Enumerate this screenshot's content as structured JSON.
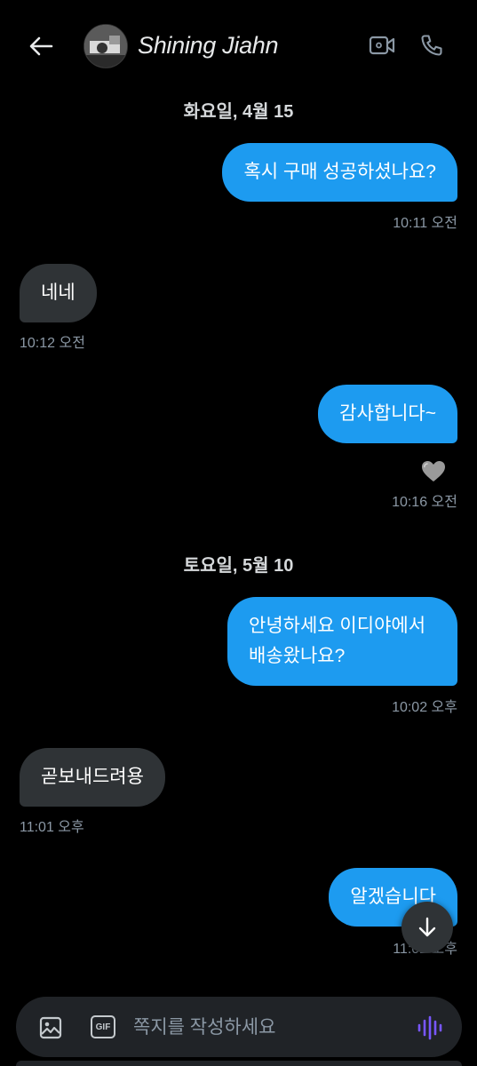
{
  "header": {
    "contact_name": "Shining Jiahn",
    "back_icon": "arrow-left-icon",
    "video_icon": "video-camera-icon",
    "call_icon": "phone-icon"
  },
  "colors": {
    "background": "#000000",
    "outgoing_bubble": "#1d9bf0",
    "incoming_bubble": "#2f3336",
    "timestamp": "#8b98a5",
    "voice_accent": "#7856ff"
  },
  "conversation": {
    "date_1": "화요일, 4월 15",
    "msg_1": {
      "text": "혹시 구매 성공하셨나요?",
      "time": "10:11 오전",
      "direction": "outgoing"
    },
    "msg_2": {
      "text": "네네",
      "time": "10:12 오전",
      "direction": "incoming"
    },
    "msg_3": {
      "text": "감사합니다~",
      "time": "10:16 오전",
      "direction": "outgoing",
      "reaction": "🤍"
    },
    "date_2": "토요일, 5월 10",
    "msg_4": {
      "line_1": "안녕하세요 이디야에서",
      "line_2": "배송왔나요?",
      "time": "10:02 오후",
      "direction": "outgoing"
    },
    "msg_5": {
      "text": "곧보내드려용",
      "time": "11:01 오후",
      "direction": "incoming"
    },
    "msg_6": {
      "text": "알겠습니다",
      "time": "11:02 오후",
      "direction": "outgoing"
    }
  },
  "composer": {
    "placeholder": "쪽지를 작성하세요",
    "gif_label": "GIF",
    "image_icon": "image-icon",
    "voice_icon": "voice-waveform-icon"
  },
  "scroll_down_icon": "arrow-down-icon"
}
